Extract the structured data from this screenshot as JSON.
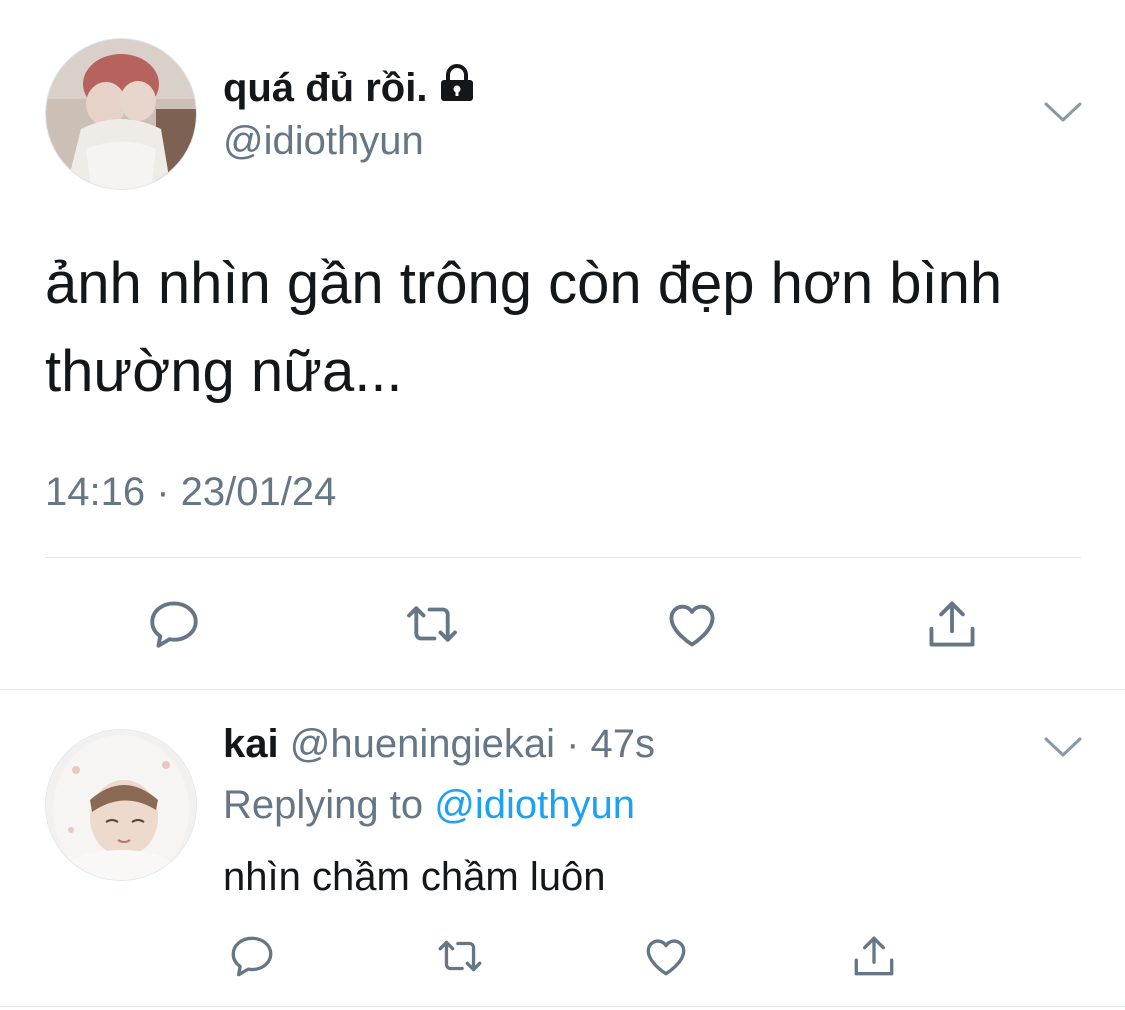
{
  "tweet": {
    "display_name": "quá đủ rồi.",
    "handle": "@idiothyun",
    "lock_icon": "lock-icon",
    "text": "ảnh nhìn gần trông còn đẹp hơn bình thường nữa...",
    "timestamp": "14:16 · 23/01/24",
    "actions": [
      "reply-icon",
      "retweet-icon",
      "like-icon",
      "share-icon"
    ]
  },
  "reply": {
    "display_name": "kai",
    "handle": "@hueningiekai",
    "time": "· 47s",
    "replying_prefix": "Replying to",
    "replying_mention": "@idiothyun",
    "text": "nhìn chầm chầm luôn",
    "actions": [
      "reply-icon",
      "retweet-icon",
      "like-icon",
      "share-icon"
    ]
  },
  "colors": {
    "text": "#14171a",
    "secondary": "#657786",
    "accent": "#1da1f2",
    "divider": "#e1e8ed"
  }
}
